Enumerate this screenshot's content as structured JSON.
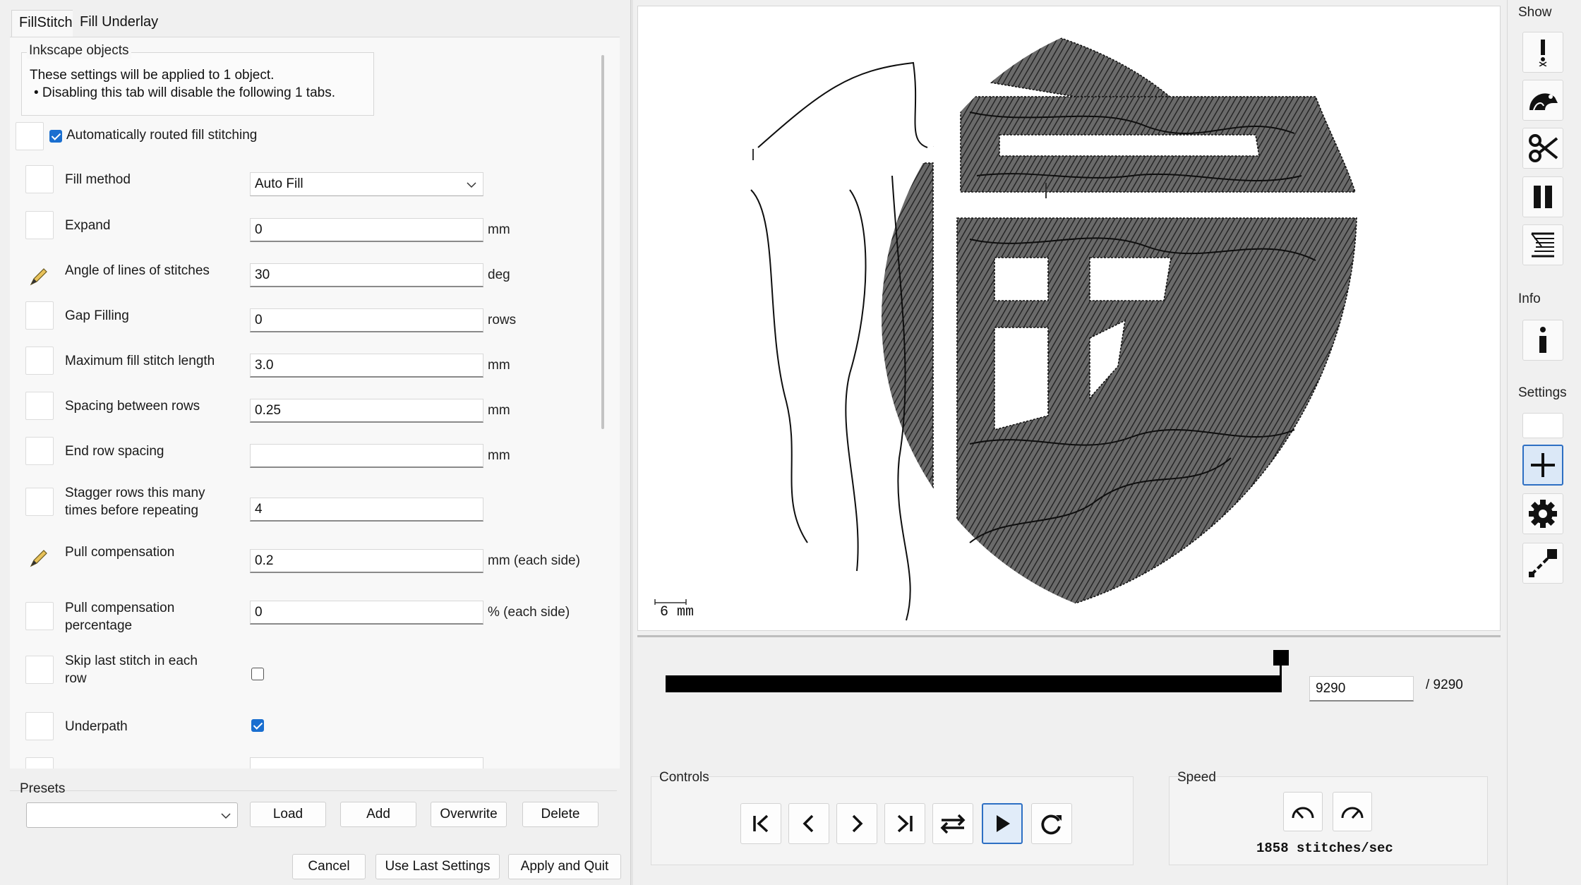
{
  "tabs": [
    "FillStitch",
    "Fill Underlay"
  ],
  "inkscape": {
    "title": "Inkscape objects",
    "line1": "These settings will be applied to 1 object.",
    "line2": "• Disabling this tab will disable the following 1 tabs."
  },
  "auto_routed": {
    "label": "Automatically routed fill stitching",
    "checked": true
  },
  "params": {
    "fill_method": {
      "label": "Fill method",
      "value": "Auto Fill"
    },
    "expand": {
      "label": "Expand",
      "value": "0",
      "unit": "mm"
    },
    "angle": {
      "label": "Angle of lines of stitches",
      "value": "30",
      "unit": "deg"
    },
    "gap": {
      "label": "Gap Filling",
      "value": "0",
      "unit": "rows"
    },
    "max_len": {
      "label": "Maximum fill stitch length",
      "value": "3.0",
      "unit": "mm"
    },
    "spacing": {
      "label": "Spacing between rows",
      "value": "0.25",
      "unit": "mm"
    },
    "end_row": {
      "label": "End row spacing",
      "value": "",
      "unit": "mm"
    },
    "stagger": {
      "label1": "Stagger rows this many",
      "label2": "times before repeating",
      "value": "4"
    },
    "pull_comp": {
      "label": "Pull compensation",
      "value": "0.2",
      "unit": "mm (each side)"
    },
    "pull_pct": {
      "label1": "Pull compensation",
      "label2": "percentage",
      "value": "0",
      "unit": "% (each side)"
    },
    "skip_last": {
      "label1": "Skip last stitch in each",
      "label2": "row",
      "checked": false
    },
    "underpath": {
      "label": "Underpath",
      "checked": true
    }
  },
  "presets": {
    "label": "Presets",
    "load": "Load",
    "add": "Add",
    "overwrite": "Overwrite",
    "delete": "Delete"
  },
  "footer": {
    "cancel": "Cancel",
    "use_last": "Use Last Settings",
    "apply_quit": "Apply and Quit"
  },
  "preview": {
    "scale_label": "6 mm",
    "stitch_current": "9290",
    "stitch_total": "/ 9290",
    "progress_fraction": 1.0
  },
  "controls": {
    "title": "Controls",
    "buttons": [
      "jump-to-start-icon",
      "step-back-icon",
      "step-forward-icon",
      "jump-to-end-icon",
      "swap-direction-icon",
      "play-icon",
      "restart-icon"
    ]
  },
  "speed": {
    "title": "Speed",
    "text": "1858 stitches/sec"
  },
  "toolbar": {
    "show_label": "Show",
    "info_label": "Info",
    "settings_label": "Settings",
    "show_icons": [
      "warning-icon",
      "jump-stitch-icon",
      "scissors-icon",
      "pause-icon",
      "command-list-icon"
    ],
    "info_icons": [
      "info-icon"
    ],
    "settings_icons": [
      "blank-toggle",
      "crosshair-plus-icon",
      "gear-icon",
      "line-handle-icon"
    ]
  },
  "colors": {
    "accent": "#1a6fd0",
    "stitch_fill": "#4a4a4a",
    "stitch_line": "#111111"
  }
}
